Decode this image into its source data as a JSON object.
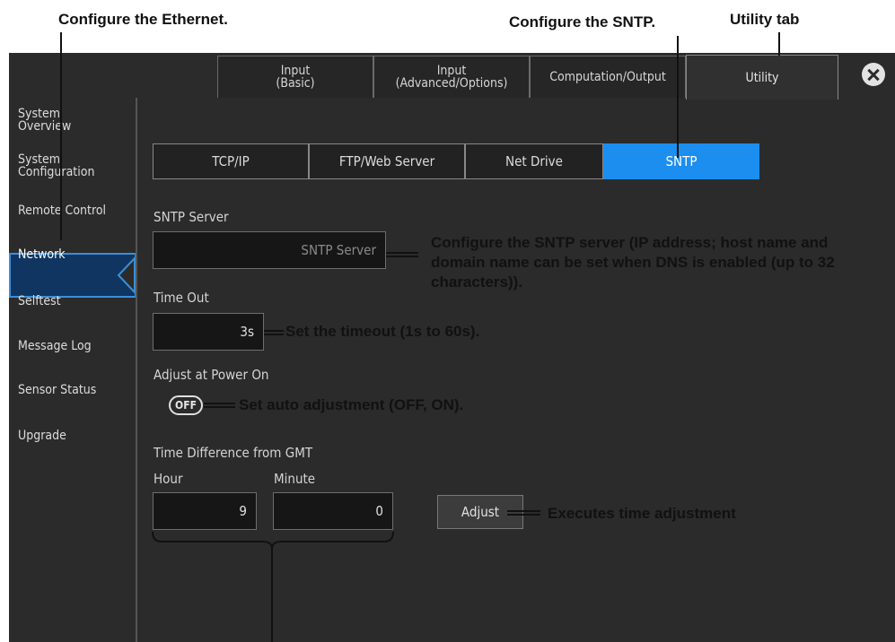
{
  "annotations": {
    "ethernet": "Configure the Ethernet.",
    "sntp": "Configure the SNTP.",
    "utility_tab": "Utility tab",
    "server": "Configure the SNTP server (IP address; host name and domain name can be set when DNS is enabled (up to 32 characters)).",
    "timeout": "Set the timeout (1s to 60s).",
    "auto_adjust": "Set auto adjustment (OFF, ON).",
    "adjust": "Executes time adjustment"
  },
  "tabs": [
    {
      "label": "Input\n(Basic)"
    },
    {
      "label": "Input\n(Advanced/Options)"
    },
    {
      "label": "Computation/Output"
    },
    {
      "label": "Utility"
    }
  ],
  "sidebar": {
    "items": [
      {
        "label": "System\nOverview"
      },
      {
        "label": "System\nConfiguration"
      },
      {
        "label": "Remote Control"
      },
      {
        "label": "Network"
      },
      {
        "label": "Selftest"
      },
      {
        "label": "Message Log"
      },
      {
        "label": "Sensor Status"
      },
      {
        "label": "Upgrade"
      }
    ]
  },
  "subtabs": [
    {
      "label": "TCP/IP"
    },
    {
      "label": "FTP/Web Server"
    },
    {
      "label": "Net Drive"
    },
    {
      "label": "SNTP"
    }
  ],
  "form": {
    "server_label": "SNTP Server",
    "server_placeholder": "SNTP Server",
    "timeout_label": "Time Out",
    "timeout_value": "3s",
    "power_on_label": "Adjust at Power On",
    "power_on_value": "OFF",
    "gmt_label": "Time Difference from GMT",
    "hour_label": "Hour",
    "minute_label": "Minute",
    "hour_value": "9",
    "minute_value": "0",
    "adjust_button": "Adjust"
  },
  "colors": {
    "accent": "#1b8ef0",
    "active_nav": "#0f3560",
    "background": "#2b2b2b"
  }
}
